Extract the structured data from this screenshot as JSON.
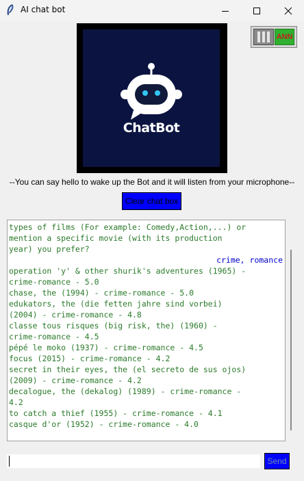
{
  "window": {
    "title": "AI chat bot"
  },
  "logo": {
    "word": "ChatBot"
  },
  "ann_toggle": {
    "label": "ANN",
    "on": true
  },
  "hint_text": "--You can say hello to wake up the Bot and it will listen from your microphone--",
  "clear_button": {
    "label": "Clear chat box"
  },
  "chat": {
    "lines": [
      {
        "text": "types of films (For example: Comedy,Action,...) or",
        "role": "bot"
      },
      {
        "text": "mention a specific movie (with its production",
        "role": "bot"
      },
      {
        "text": "year) you prefer?",
        "role": "bot"
      },
      {
        "text": "crime, romance",
        "role": "user"
      },
      {
        "text": "operation 'y' & other shurik's adventures (1965) -",
        "role": "bot"
      },
      {
        "text": "crime-romance - 5.0",
        "role": "bot"
      },
      {
        "text": "chase, the (1994) - crime-romance - 5.0",
        "role": "bot"
      },
      {
        "text": "edukators, the (die fetten jahre sind vorbei)",
        "role": "bot"
      },
      {
        "text": "(2004) - crime-romance - 4.8",
        "role": "bot"
      },
      {
        "text": "classe tous risques (big risk, the) (1960) -",
        "role": "bot"
      },
      {
        "text": "crime-romance - 4.5",
        "role": "bot"
      },
      {
        "text": "pépé le moko (1937) - crime-romance - 4.5",
        "role": "bot"
      },
      {
        "text": "focus (2015) - crime-romance - 4.2",
        "role": "bot"
      },
      {
        "text": "secret in their eyes, the (el secreto de sus ojos)",
        "role": "bot"
      },
      {
        "text": "(2009) - crime-romance - 4.2",
        "role": "bot"
      },
      {
        "text": "decalogue, the (dekalog) (1989) - crime-romance -",
        "role": "bot"
      },
      {
        "text": "4.2",
        "role": "bot"
      },
      {
        "text": "to catch a thief (1955) - crime-romance - 4.1",
        "role": "bot"
      },
      {
        "text": "casque d'or (1952) - crime-romance - 4.0",
        "role": "bot"
      }
    ]
  },
  "input": {
    "value": ""
  },
  "send_button": {
    "label": "Send"
  },
  "colors": {
    "bot_text": "#2a7a2a",
    "user_text": "#0000cd",
    "button_bg": "#0000ff",
    "logo_bg": "#0b1440"
  }
}
